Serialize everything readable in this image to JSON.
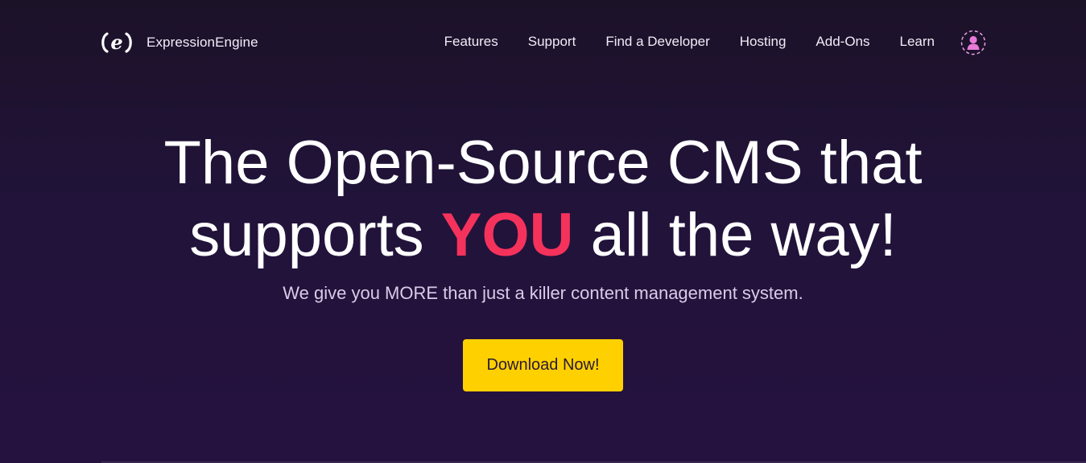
{
  "brand": {
    "name": "ExpressionEngine",
    "logo_icon": "expressionengine-e-logo-icon"
  },
  "nav": {
    "items": [
      {
        "label": "Features"
      },
      {
        "label": "Support"
      },
      {
        "label": "Find a Developer"
      },
      {
        "label": "Hosting"
      },
      {
        "label": "Add-Ons"
      },
      {
        "label": "Learn"
      }
    ],
    "account_icon": "user-avatar-icon"
  },
  "hero": {
    "headline_line1": "The Open-Source CMS that",
    "headline_line2_pre": "supports ",
    "headline_line2_accent": "YOU",
    "headline_line2_post": " all the way!",
    "subhead": "We give you MORE than just a killer content management system.",
    "cta_label": "Download Now!"
  },
  "colors": {
    "background": "#21133a",
    "accent_pink": "#f5325c",
    "cta_yellow": "#ffd000",
    "avatar_pink": "#e77ad8"
  }
}
